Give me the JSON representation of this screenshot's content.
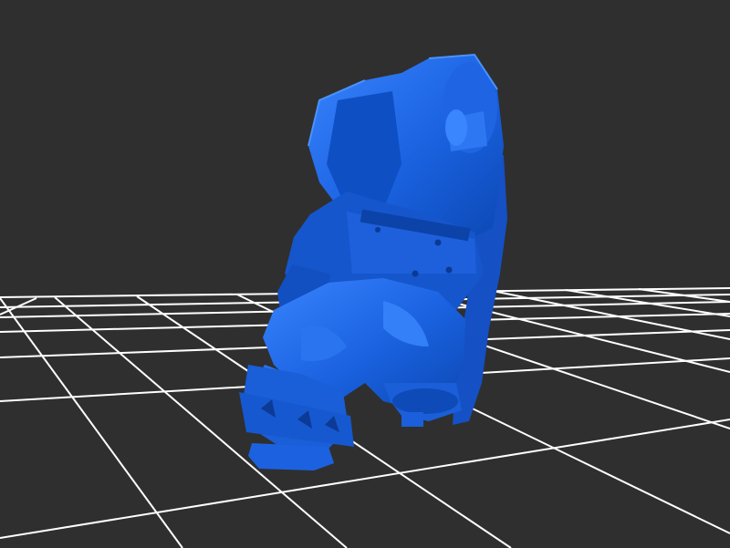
{
  "viewer": {
    "background_color": "#2f2f2f",
    "grid_color": "#ffffff",
    "model_color": "#1a62e0",
    "model_highlight": "#3d86ff",
    "model_shadow": "#0b3e9e"
  }
}
